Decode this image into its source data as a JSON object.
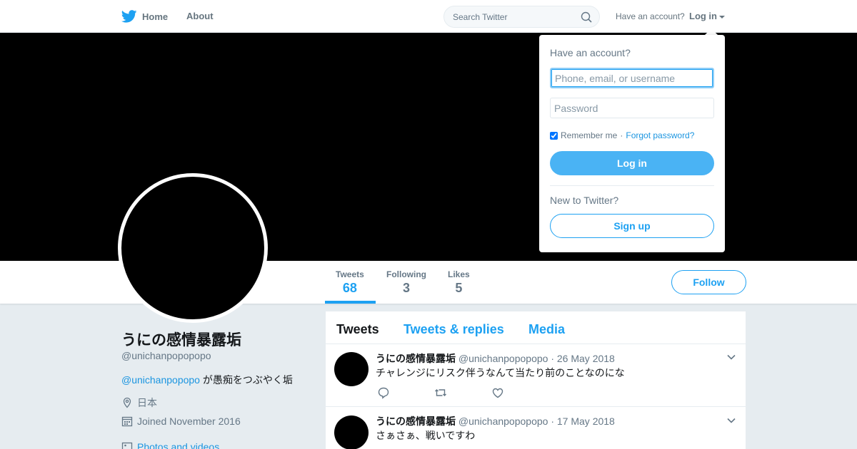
{
  "nav": {
    "home_label": "Home",
    "about_label": "About",
    "search_placeholder": "Search Twitter",
    "have_account": "Have an account?",
    "login_label": "Log in"
  },
  "profile": {
    "name": "うにの感情暴露垢",
    "handle": "@unichanpopopopo",
    "bio_mention": "@unichanpopopo",
    "bio_text": " が愚痴をつぶやく垢",
    "location": "日本",
    "joined": "Joined November 2016",
    "photos_link": "Photos and videos",
    "follow_label": "Follow"
  },
  "stats": [
    {
      "label": "Tweets",
      "value": "68"
    },
    {
      "label": "Following",
      "value": "3"
    },
    {
      "label": "Likes",
      "value": "5"
    }
  ],
  "timeline": {
    "tabs": [
      "Tweets",
      "Tweets & replies",
      "Media"
    ],
    "tweets": [
      {
        "name": "うにの感情暴露垢",
        "handle": "@unichanpopopopo",
        "date": "26 May 2018",
        "text": "チャレンジにリスク伴うなんて当たり前のことなのにな"
      },
      {
        "name": "うにの感情暴露垢",
        "handle": "@unichanpopopopo",
        "date": "17 May 2018",
        "text": "さぁさぁ、戦いですわ"
      }
    ]
  },
  "login_dropdown": {
    "title": "Have an account?",
    "username_placeholder": "Phone, email, or username",
    "password_placeholder": "Password",
    "remember_label": "Remember me",
    "separator": "·",
    "forgot_label": "Forgot password?",
    "login_button": "Log in",
    "new_label": "New to Twitter?",
    "signup_button": "Sign up"
  },
  "colors": {
    "brand_blue": "#1da1f2",
    "login_button_bg": "#4ab3f4",
    "page_bg": "#e6ecf0"
  },
  "icons": [
    "twitter-bird-icon",
    "search-icon",
    "location-icon",
    "calendar-icon",
    "photo-icon",
    "reply-icon",
    "retweet-icon",
    "like-icon",
    "chevron-down-icon"
  ]
}
